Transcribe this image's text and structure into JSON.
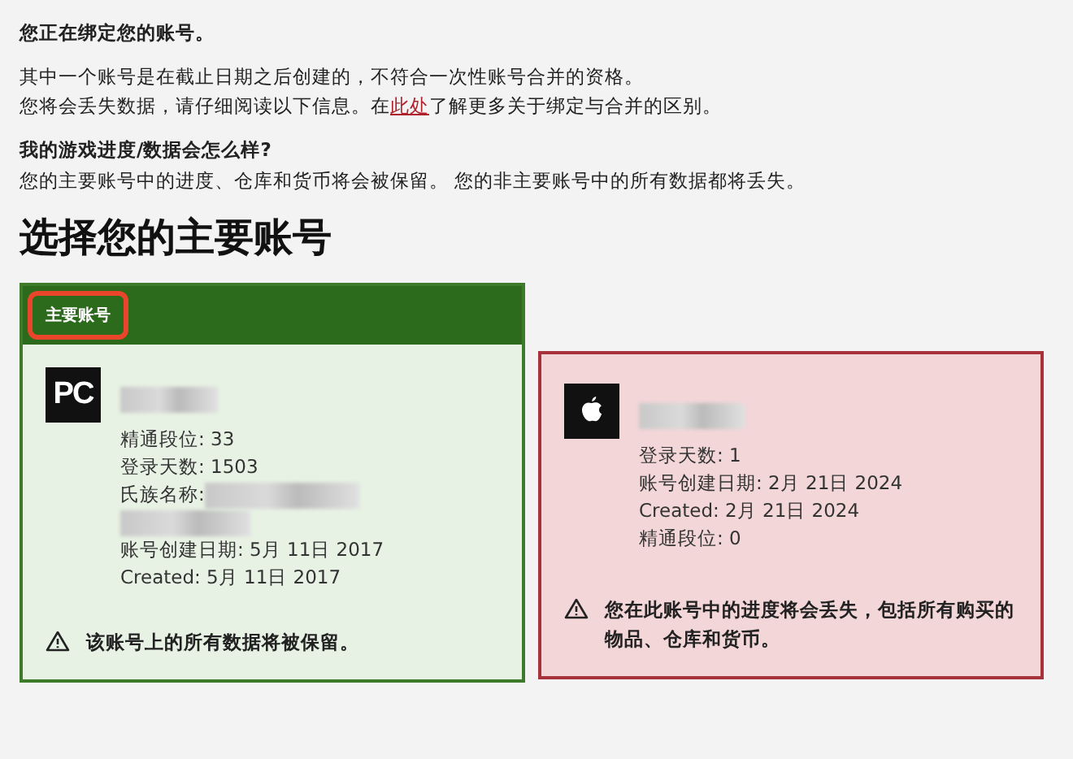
{
  "heading": "您正在绑定您的账号。",
  "notice_lines": [
    "其中一个账号是在截止日期之后创建的，不符合一次性账号合并的资格。",
    {
      "before": "您将会丢失数据，请仔细阅读以下信息。在",
      "link": "此处",
      "after": "了解更多关于绑定与合并的区别。"
    }
  ],
  "question": "我的游戏进度/数据会怎么样?",
  "answer": "您的主要账号中的进度、仓库和货币将会被保留。 您的非主要账号中的所有数据都将丢失。",
  "title": "选择您的主要账号",
  "accounts": [
    {
      "primary": true,
      "badge": "主要账号",
      "badge_highlighted": true,
      "kind": "pc",
      "platform_label": "PC",
      "lines": [
        {
          "kind": "blur"
        },
        {
          "kind": "text",
          "text": "精通段位: 33"
        },
        {
          "kind": "text",
          "text": "登录天数: 1503"
        },
        {
          "kind": "text_blur",
          "text": "氏族名称:"
        },
        {
          "kind": "blur"
        },
        {
          "kind": "text",
          "text": "账号创建日期: 5月 11日 2017"
        },
        {
          "kind": "text",
          "text": "Created: 5月 11日 2017"
        }
      ],
      "warning": "该账号上的所有数据将被保留。"
    },
    {
      "primary": false,
      "kind": "apple",
      "lines": [
        {
          "kind": "blur"
        },
        {
          "kind": "text",
          "text": "登录天数: 1"
        },
        {
          "kind": "text",
          "text": "账号创建日期: 2月 21日 2024"
        },
        {
          "kind": "text",
          "text": "Created: 2月 21日 2024"
        },
        {
          "kind": "text",
          "text": "精通段位: 0"
        }
      ],
      "warning": "您在此账号中的进度将会丢失，包括所有购买的物品、仓库和货币。"
    }
  ]
}
